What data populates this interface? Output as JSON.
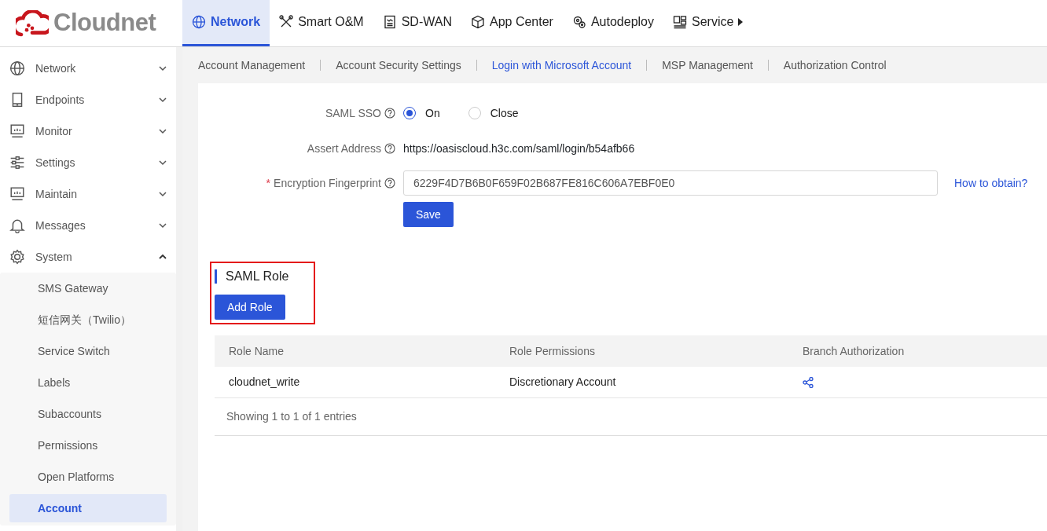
{
  "brand": {
    "name": "Cloudnet"
  },
  "top_nav": [
    {
      "label": "Network",
      "selected": true
    },
    {
      "label": "Smart O&M",
      "selected": false
    },
    {
      "label": "SD-WAN",
      "selected": false
    },
    {
      "label": "App Center",
      "selected": false
    },
    {
      "label": "Autodeploy",
      "selected": false
    },
    {
      "label": "Service",
      "selected": false,
      "has_submenu": true
    }
  ],
  "sidebar": {
    "items": [
      {
        "label": "Network",
        "expanded": false
      },
      {
        "label": "Endpoints",
        "expanded": false
      },
      {
        "label": "Monitor",
        "expanded": false
      },
      {
        "label": "Settings",
        "expanded": false
      },
      {
        "label": "Maintain",
        "expanded": false
      },
      {
        "label": "Messages",
        "expanded": false
      },
      {
        "label": "System",
        "expanded": true,
        "children": [
          {
            "label": "SMS Gateway",
            "selected": false
          },
          {
            "label": "短信网关（Twilio）",
            "selected": false
          },
          {
            "label": "Service Switch",
            "selected": false
          },
          {
            "label": "Labels",
            "selected": false
          },
          {
            "label": "Subaccounts",
            "selected": false
          },
          {
            "label": "Permissions",
            "selected": false
          },
          {
            "label": "Open Platforms",
            "selected": false
          },
          {
            "label": "Account",
            "selected": true
          }
        ]
      }
    ]
  },
  "sub_tabs": [
    {
      "label": "Account Management",
      "selected": false
    },
    {
      "label": "Account Security Settings",
      "selected": false
    },
    {
      "label": "Login with Microsoft Account",
      "selected": true
    },
    {
      "label": "MSP Management",
      "selected": false
    },
    {
      "label": "Authorization Control",
      "selected": false
    }
  ],
  "form": {
    "saml_sso": {
      "label": "SAML SSO",
      "options": [
        {
          "label": "On",
          "selected": true
        },
        {
          "label": "Close",
          "selected": false
        }
      ]
    },
    "assert_address": {
      "label": "Assert Address",
      "value": "https://oasiscloud.h3c.com/saml/login/b54afb66"
    },
    "fingerprint": {
      "label": "Encryption Fingerprint",
      "required_mark": "*",
      "value": "6229F4D7B6B0F659F02B687FE816C606A7EBF0E0",
      "help_link": "How to obtain?"
    },
    "save_button": "Save"
  },
  "saml_role": {
    "title": "SAML Role",
    "highlighted": true,
    "add_button": "Add Role",
    "table": {
      "columns": [
        "Role Name",
        "Role Permissions",
        "Branch Authorization"
      ],
      "rows": [
        [
          "cloudnet_write",
          "Discretionary Account",
          {
            "kind": "share-icon"
          }
        ]
      ]
    },
    "footer": "Showing 1 to 1 of 1 entries"
  }
}
